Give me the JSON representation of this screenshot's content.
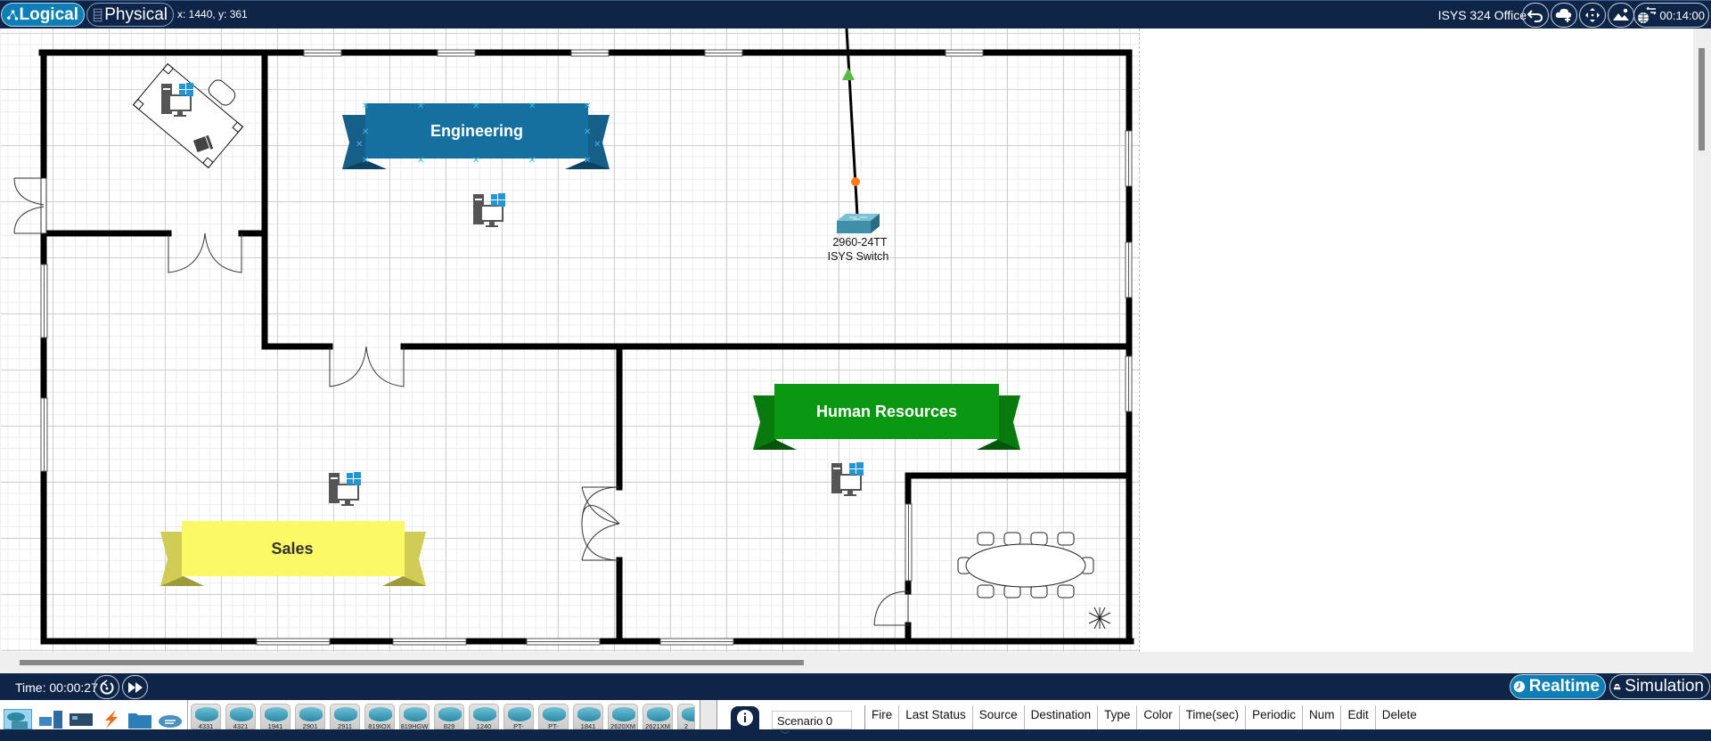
{
  "topbar": {
    "logical_label": "Logical",
    "physical_label": "Physical",
    "coords": "x: 1440, y: 361",
    "location": "ISYS 324 Office",
    "clock": "00:14:00",
    "icons": [
      "back-icon",
      "new-cluster-icon",
      "move-object-icon",
      "set-background-icon",
      "viewport-icon"
    ]
  },
  "floorplan": {
    "rooms": [
      {
        "name": "Engineering",
        "banner_color": "#1570a0"
      },
      {
        "name": "Human Resources",
        "banner_color": "#0a9712"
      },
      {
        "name": "Sales",
        "banner_color": "#fcf967"
      }
    ],
    "devices": [
      {
        "model": "2960-24TT",
        "name": "ISYS Switch",
        "type": "switch"
      }
    ],
    "pcs": [
      "office-pc",
      "engineering-pc",
      "hr-pc",
      "sales-pc"
    ],
    "link_colors": {
      "link_up": "#5cb848",
      "link_pending": "#ff7a1a"
    }
  },
  "bottombar": {
    "time_label": "Time: 00:00:27",
    "realtime_label": "Realtime",
    "simulation_label": "Simulation"
  },
  "devicebar": {
    "categories": [
      "network-devices",
      "end-devices",
      "components",
      "connections",
      "miscellaneous",
      "multiuser-connection"
    ],
    "devices": [
      "4331",
      "4321",
      "1941",
      "2901",
      "2911",
      "819IOX",
      "819HGW",
      "829",
      "1240",
      "PT-Router",
      "PT-Empty",
      "1841",
      "2620XM",
      "2621XM",
      "2"
    ],
    "scenario": "Scenario 0",
    "pdu_columns": [
      "Fire",
      "Last Status",
      "Source",
      "Destination",
      "Type",
      "Color",
      "Time(sec)",
      "Periodic",
      "Num",
      "Edit",
      "Delete"
    ]
  }
}
